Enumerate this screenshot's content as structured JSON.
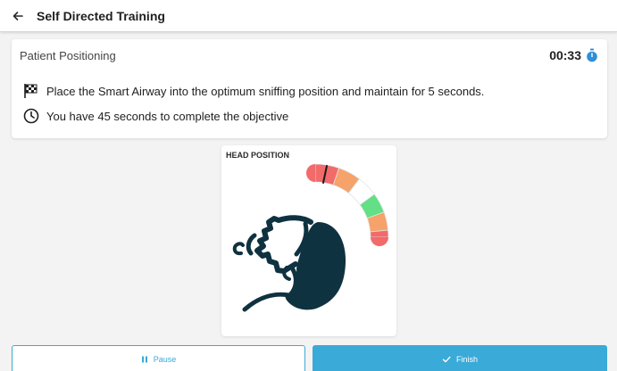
{
  "appbar": {
    "title": "Self Directed Training",
    "back_icon": "arrow-left-icon"
  },
  "objective_card": {
    "title": "Patient Positioning",
    "timer": "00:33",
    "timer_icon": "stopwatch-icon",
    "instruction": "Place the Smart Airway into the optimum sniffing position and maintain for 5 seconds.",
    "instruction_icon": "checkered-flag-icon",
    "time_limit": "You have 45 seconds to complete the objective",
    "time_limit_icon": "clock-icon"
  },
  "head_position": {
    "label": "HEAD POSITION",
    "gauge_segments": [
      "#f26a6a",
      "#f5a36a",
      "#ffffff",
      "#63df86",
      "#f5a36a",
      "#f26a6a"
    ]
  },
  "actions": {
    "pause_label": "Pause",
    "pause_icon": "pause-icon",
    "finish_label": "Finish",
    "finish_icon": "check-icon"
  },
  "colors": {
    "accent": "#3aaad8",
    "timer_icon": "#2f8fd8",
    "head_fill": "#0f3240"
  }
}
